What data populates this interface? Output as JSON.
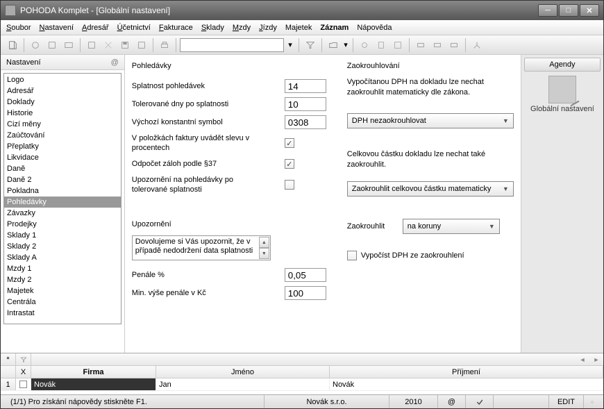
{
  "window": {
    "title": "POHODA Komplet - [Globální nastavení]"
  },
  "menu": {
    "items": [
      "Soubor",
      "Nastavení",
      "Adresář",
      "Účetnictví",
      "Fakturace",
      "Sklady",
      "Mzdy",
      "Jízdy",
      "Majetek",
      "Záznam",
      "Nápověda"
    ],
    "underline": [
      "S",
      "N",
      "A",
      "Ú",
      "F",
      "S",
      "M",
      "J",
      "",
      "",
      ""
    ],
    "bold_index": 9
  },
  "sidebar": {
    "title": "Nastavení",
    "items": [
      "Logo",
      "Adresář",
      "Doklady",
      "Historie",
      "Cizí měny",
      "Zaúčtování",
      "Přeplatky",
      "Likvidace",
      "Daně",
      "Daně 2",
      "Pokladna",
      "Pohledávky",
      "Závazky",
      "Prodejky",
      "Sklady 1",
      "Sklady 2",
      "Sklady A",
      "Mzdy 1",
      "Mzdy 2",
      "Majetek",
      "Centrála",
      "Intrastat"
    ],
    "selected_index": 11
  },
  "pohledavky": {
    "title": "Pohledávky",
    "labels": {
      "splatnost": "Splatnost pohledávek",
      "tolerovane": "Tolerované dny po splatnosti",
      "ksymbol": "Výchozí konstantní symbol",
      "sleva": "V položkách faktury uvádět slevu v procentech",
      "odpocet": "Odpočet záloh podle §37",
      "upozorneni_po": "Upozornění na pohledávky po tolerované splatnosti",
      "upozorneni_hd": "Upozornění",
      "upozorneni_text": "Dovolujeme si Vás upozornit, že v případě nedodržení data splatnosti",
      "penale": "Penále %",
      "min_penale": "Min. výše penále v Kč"
    },
    "values": {
      "splatnost": "14",
      "tolerovane": "10",
      "ksymbol": "0308",
      "sleva": true,
      "odpocet": true,
      "upozorneni_po": false,
      "penale": "0,05",
      "min_penale": "100"
    }
  },
  "zaokrouhlovani": {
    "title": "Zaokrouhlování",
    "dph_text": "Vypočítanou DPH na dokladu lze nechat zaokrouhlit matematicky dle zákona.",
    "dph_combo": "DPH nezaokrouhlovat",
    "celkova_text": "Celkovou částku dokladu lze nechat také zaokrouhlit.",
    "celkova_combo": "Zaokrouhlit celkovou částku matematicky",
    "zaokrouhlit_lbl": "Zaokrouhlit",
    "zaokrouhlit_combo": "na koruny",
    "vypocist_chk": false,
    "vypocist_lbl": "Vypočíst DPH ze zaokrouhlení"
  },
  "agendy": {
    "title": "Agendy",
    "item": "Globální nastavení"
  },
  "grid": {
    "headers": {
      "x": "X",
      "firma": "Firma",
      "jmeno": "Jméno",
      "prijmeni": "Příjmení"
    },
    "row": {
      "num": "1",
      "firma": "Novák",
      "jmeno": "Jan",
      "prijmeni": "Novák"
    }
  },
  "status": {
    "left": "(1/1) Pro získání nápovědy stiskněte F1.",
    "company": "Novák  s.r.o.",
    "year": "2010",
    "at": "@",
    "edit": "EDIT"
  }
}
